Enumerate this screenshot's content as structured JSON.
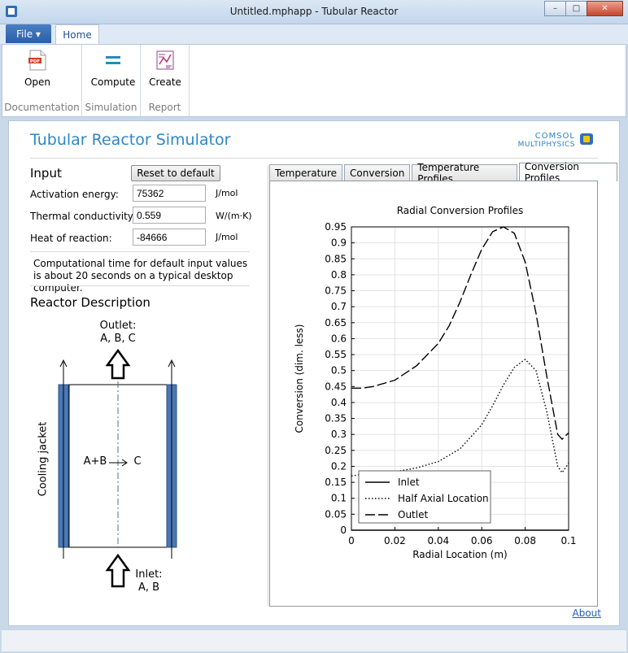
{
  "window": {
    "title": "Untitled.mphapp - Tubular Reactor",
    "minimize_glyph": "–",
    "maximize_glyph": "□",
    "close_glyph": "✕"
  },
  "ribbon": {
    "file_label": "File ▾",
    "home_tab": "Home",
    "groups": [
      {
        "name": "Documentation",
        "button": "Open",
        "icon": "pdf-icon"
      },
      {
        "name": "Simulation",
        "button": "Compute",
        "icon": "compute-icon"
      },
      {
        "name": "Report",
        "button": "Create",
        "icon": "report-icon"
      }
    ]
  },
  "app": {
    "title": "Tubular Reactor Simulator",
    "logo_line1": "COMSOL",
    "logo_line2": "MULTIPHYSICS",
    "about": "About"
  },
  "input": {
    "title": "Input",
    "reset_label": "Reset to default",
    "fields": [
      {
        "label": "Activation energy:",
        "value": "75362",
        "unit": "J/mol"
      },
      {
        "label": "Thermal conductivity:",
        "value": "0.559",
        "unit": "W/(m·K)"
      },
      {
        "label": "Heat of reaction:",
        "value": "-84666",
        "unit": "J/mol"
      }
    ],
    "note": "Computational time for default input values is about 20 seconds on a typical desktop computer."
  },
  "reactor": {
    "title": "Reactor Description",
    "outlet_line1": "Outlet:",
    "outlet_line2": "A, B, C",
    "reaction_left": "A+B",
    "reaction_right": "C",
    "jacket": "Cooling jacket",
    "inlet_line1": "Inlet:",
    "inlet_line2": "A, B"
  },
  "tabs": [
    "Temperature",
    "Conversion",
    "Temperature Profiles",
    "Conversion Profiles"
  ],
  "active_tab": 3,
  "chart_data": {
    "type": "line",
    "title": "Radial Conversion Profiles",
    "xlabel": "Radial Location (m)",
    "ylabel": "Conversion (dim. less)",
    "xlim": [
      0,
      0.1
    ],
    "ylim": [
      0,
      0.95
    ],
    "xticks": [
      0,
      0.02,
      0.04,
      0.06,
      0.08,
      0.1
    ],
    "xtick_labels": [
      "0",
      "0.02",
      "0.04",
      "0.06",
      "0.08",
      "0.1"
    ],
    "yticks": [
      0,
      0.05,
      0.1,
      0.15,
      0.2,
      0.25,
      0.3,
      0.35,
      0.4,
      0.45,
      0.5,
      0.55,
      0.6,
      0.65,
      0.7,
      0.75,
      0.8,
      0.85,
      0.9,
      0.95
    ],
    "ytick_labels": [
      "0",
      "0.05",
      "0.1",
      "0.15",
      "0.2",
      "0.25",
      "0.3",
      "0.35",
      "0.4",
      "0.45",
      "0.5",
      "0.55",
      "0.6",
      "0.65",
      "0.7",
      "0.75",
      "0.8",
      "0.85",
      "0.9",
      "0.95"
    ],
    "grid": true,
    "legend_position": "bottom-left",
    "series": [
      {
        "name": "Inlet",
        "style": "solid",
        "x": [
          0,
          0.01,
          0.02,
          0.03,
          0.04,
          0.05,
          0.06,
          0.07,
          0.08,
          0.09,
          0.1
        ],
        "y": [
          0,
          0,
          0,
          0,
          0,
          0,
          0,
          0,
          0,
          0,
          0
        ]
      },
      {
        "name": "Half Axial Location",
        "style": "dotted",
        "x": [
          0,
          0.005,
          0.01,
          0.02,
          0.03,
          0.04,
          0.05,
          0.06,
          0.065,
          0.07,
          0.075,
          0.08,
          0.085,
          0.09,
          0.095,
          0.097,
          0.1
        ],
        "y": [
          0.17,
          0.175,
          0.178,
          0.183,
          0.195,
          0.215,
          0.255,
          0.33,
          0.39,
          0.455,
          0.51,
          0.535,
          0.5,
          0.37,
          0.2,
          0.18,
          0.21
        ]
      },
      {
        "name": "Outlet",
        "style": "dashed",
        "x": [
          0,
          0.005,
          0.01,
          0.02,
          0.03,
          0.04,
          0.045,
          0.05,
          0.055,
          0.06,
          0.065,
          0.07,
          0.075,
          0.08,
          0.085,
          0.09,
          0.095,
          0.097,
          0.1
        ],
        "y": [
          0.445,
          0.445,
          0.45,
          0.47,
          0.515,
          0.585,
          0.64,
          0.715,
          0.8,
          0.88,
          0.935,
          0.95,
          0.93,
          0.84,
          0.68,
          0.48,
          0.3,
          0.285,
          0.305
        ]
      }
    ]
  }
}
